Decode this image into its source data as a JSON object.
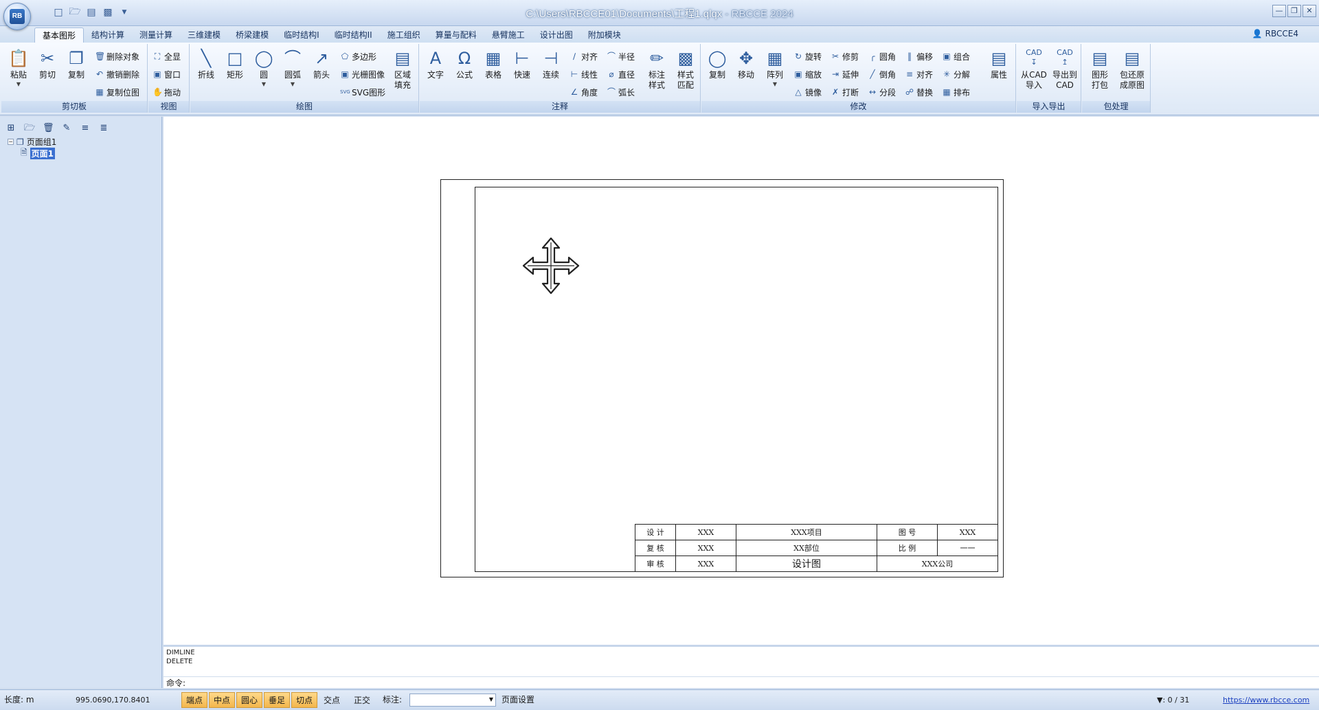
{
  "window": {
    "title": "C:\\Users\\RBCCE01\\Documents\\工程1.qlqx",
    "app_suffix": " - RBCCE 2024",
    "logo_text": "RB",
    "controls": [
      "minimize",
      "restore",
      "close"
    ]
  },
  "quick_access": [
    "new-icon",
    "open-icon",
    "save-icon",
    "save-as-icon",
    "customize-icon"
  ],
  "tabs": [
    {
      "label": "基本图形",
      "active": true
    },
    {
      "label": "结构计算"
    },
    {
      "label": "测量计算"
    },
    {
      "label": "三维建模"
    },
    {
      "label": "桥梁建模"
    },
    {
      "label": "临时结构I"
    },
    {
      "label": "临时结构II"
    },
    {
      "label": "施工组织"
    },
    {
      "label": "算量与配料"
    },
    {
      "label": "悬臂施工"
    },
    {
      "label": "设计出图"
    },
    {
      "label": "附加模块"
    }
  ],
  "user": "RBCCE4",
  "ribbon": {
    "clipboard": {
      "label": "剪切板",
      "paste": "粘贴",
      "cut": "剪切",
      "copy": "复制",
      "delete_obj": "删除对象",
      "undo_delete": "撤销删除",
      "copy_bitmap": "复制位图"
    },
    "view": {
      "label": "视图",
      "all": "全显",
      "window": "窗口",
      "drag": "拖动"
    },
    "draw": {
      "label": "绘图",
      "polyline": "折线",
      "rect": "矩形",
      "circle": "圆",
      "arc": "圆弧",
      "arrow": "箭头",
      "polygon": "多边形",
      "raster": "光栅图像",
      "svg": "SVG图形",
      "fill_1": "区域",
      "fill_2": "填充"
    },
    "annotate": {
      "label": "注释",
      "text": "文字",
      "formula": "公式",
      "table": "表格",
      "quick": "快速",
      "continuous": "连续",
      "align": "对齐",
      "linear": "线性",
      "angle": "角度",
      "radius": "半径",
      "diameter": "直径",
      "arclen": "弧长",
      "dimstyle_1": "标注",
      "dimstyle_2": "样式",
      "matchstyle_1": "样式",
      "matchstyle_2": "匹配"
    },
    "modify": {
      "label": "修改",
      "copy": "复制",
      "move": "移动",
      "array": "阵列",
      "rotate": "旋转",
      "scale": "缩放",
      "mirror": "镜像",
      "trim": "修剪",
      "extend": "延伸",
      "break": "打断",
      "fillet": "圆角",
      "chamfer": "倒角",
      "divide": "分段",
      "offset": "偏移",
      "align": "对齐",
      "replace": "替换",
      "group": "组合",
      "explode": "分解",
      "arrange": "排布",
      "properties": "属性"
    },
    "io": {
      "label": "导入导出",
      "from_cad_icon": "CAD",
      "from_cad_1": "从CAD",
      "from_cad_2": "导入",
      "to_cad_icon": "CAD",
      "to_cad_1": "导出到",
      "to_cad_2": "CAD"
    },
    "package": {
      "label": "包处理",
      "pack_1": "图形",
      "pack_2": "打包",
      "restore_1": "包还原",
      "restore_2": "成原图"
    }
  },
  "tree": {
    "group": "页面组1",
    "page": "页面1"
  },
  "title_block": {
    "design_label": "设 计",
    "design_value": "XXX",
    "project": "XXX项目",
    "drawing_no_label": "图 号",
    "drawing_no_value": "XXX",
    "review_label": "复 核",
    "review_value": "XXX",
    "part": "XX部位",
    "scale_label": "比 例",
    "scale_value": "一一",
    "check_label": "审 核",
    "check_value": "XXX",
    "drawing_name": "设计图",
    "company": "XXX公司"
  },
  "command": {
    "history": [
      "DIMLINE",
      "DELETE"
    ],
    "prompt": "命令:"
  },
  "status": {
    "length_label": "长度: m",
    "coords": "995.0690,170.8401",
    "snaps": [
      {
        "label": "端点",
        "on": true
      },
      {
        "label": "中点",
        "on": true
      },
      {
        "label": "圆心",
        "on": true
      },
      {
        "label": "垂足",
        "on": true
      },
      {
        "label": "切点",
        "on": true
      },
      {
        "label": "交点",
        "on": false
      },
      {
        "label": "正交",
        "on": false
      }
    ],
    "dim_label": "标注:",
    "dim_value": "",
    "page_setup": "页面设置",
    "filter_count": ": 0 / 31",
    "website": "https://www.rbcce.com"
  }
}
